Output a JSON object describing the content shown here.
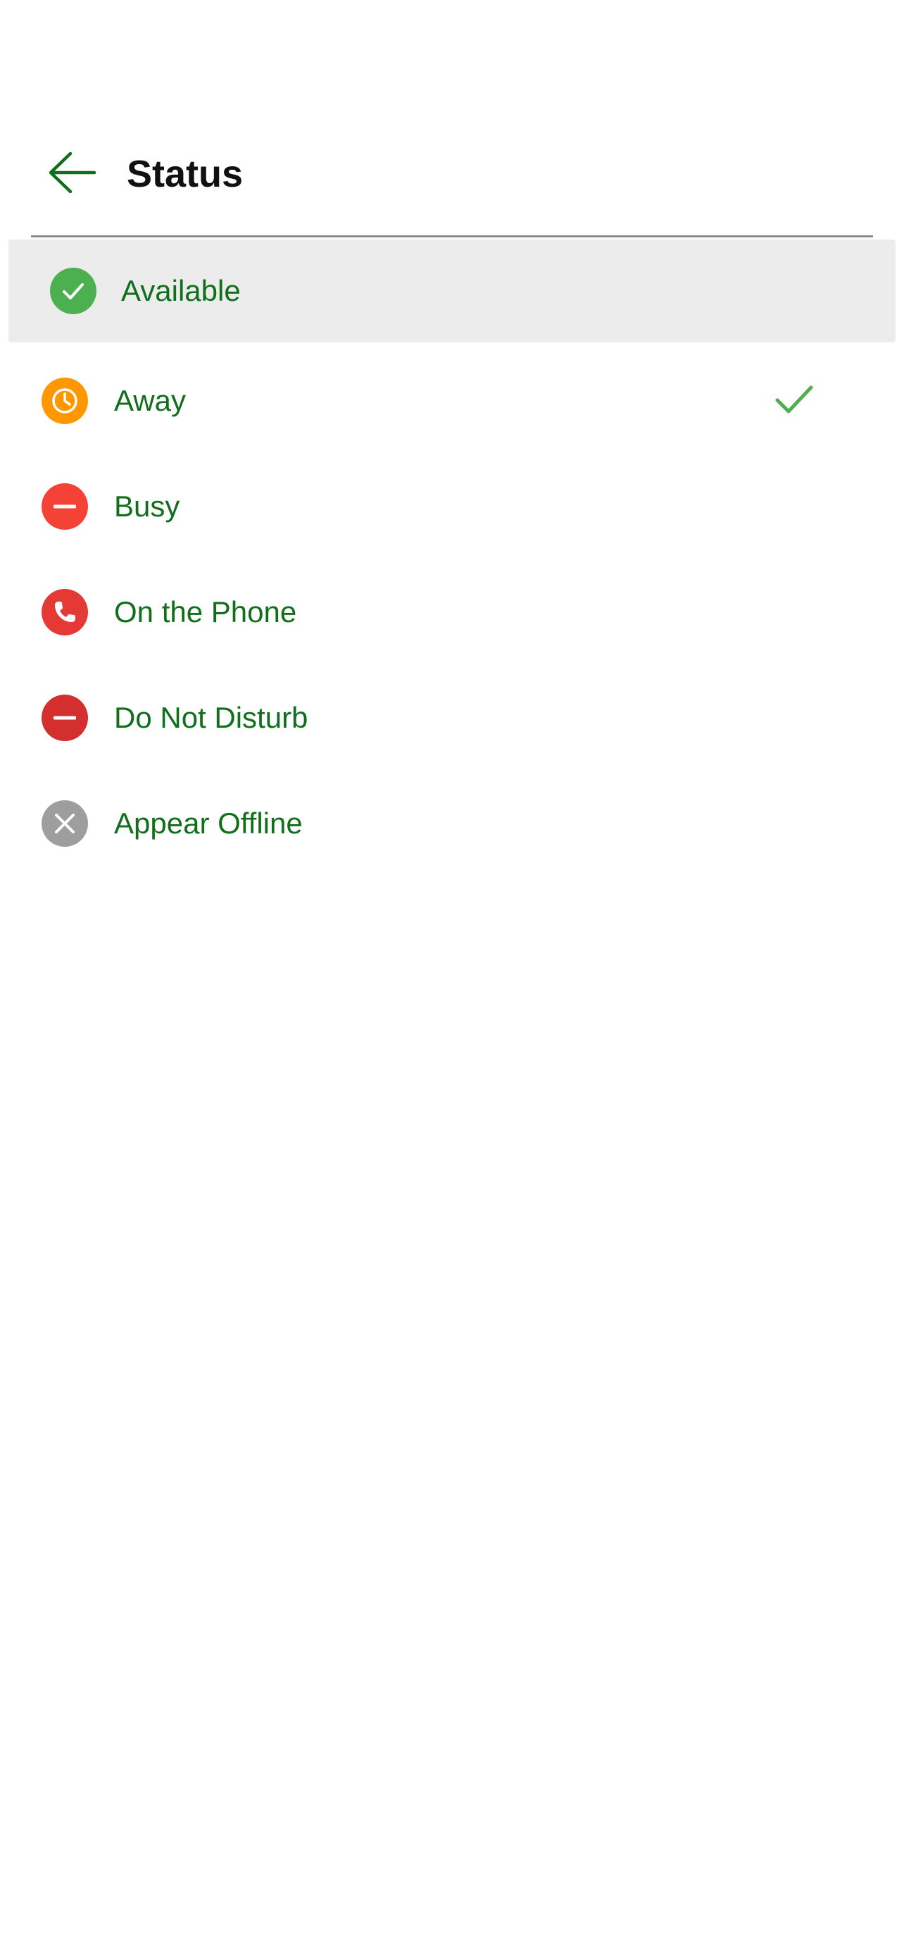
{
  "header": {
    "title": "Status",
    "back_icon": "arrow-left-icon"
  },
  "colors": {
    "accent_text": "#116e1b",
    "available": "#4caf50",
    "away": "#ff9800",
    "busy": "#f44336",
    "on_the_phone": "#e53935",
    "do_not_disturb": "#d32f2f",
    "offline": "#9e9e9e",
    "selected_row_bg": "#ececec"
  },
  "statuses": [
    {
      "label": "Available",
      "icon": "check-circle-icon",
      "highlighted": true,
      "checked": false
    },
    {
      "label": "Away",
      "icon": "clock-icon",
      "highlighted": false,
      "checked": true
    },
    {
      "label": "Busy",
      "icon": "minus-circle-icon",
      "highlighted": false,
      "checked": false
    },
    {
      "label": "On the Phone",
      "icon": "phone-icon",
      "highlighted": false,
      "checked": false
    },
    {
      "label": "Do Not Disturb",
      "icon": "minus-circle-icon",
      "highlighted": false,
      "checked": false
    },
    {
      "label": "Appear Offline",
      "icon": "close-circle-icon",
      "highlighted": false,
      "checked": false
    }
  ]
}
